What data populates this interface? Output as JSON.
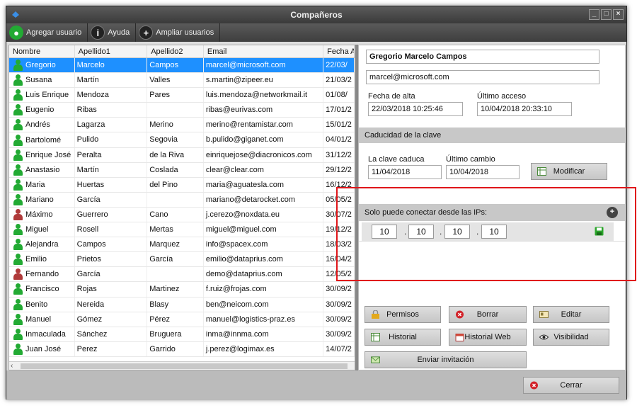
{
  "window": {
    "title": "Compañeros"
  },
  "toolbar": {
    "add_user": "Agregar usuario",
    "help": "Ayuda",
    "expand_users": "Ampliar usuarios"
  },
  "columns": [
    "Nombre",
    "Apellido1",
    "Apellido2",
    "Email",
    "Fecha A"
  ],
  "rows": [
    {
      "n": "Gregorio",
      "a1": "Marcelo",
      "a2": "Campos",
      "e": "marcel@microsoft.com",
      "f": "22/03/",
      "status": "green"
    },
    {
      "n": "Susana",
      "a1": "Martín",
      "a2": "Valles",
      "e": "s.martin@zipeer.eu",
      "f": "21/03/2",
      "status": "green"
    },
    {
      "n": "Luis Enrique",
      "a1": "Mendoza",
      "a2": "Pares",
      "e": "luis.mendoza@networkmail.it",
      "f": "01/08/",
      "status": "green"
    },
    {
      "n": "Eugenio",
      "a1": "Ribas",
      "a2": "",
      "e": "ribas@eurivas.com",
      "f": "17/01/2",
      "status": "green"
    },
    {
      "n": "Andrés",
      "a1": "Lagarza",
      "a2": "Merino",
      "e": "merino@rentamistar.com",
      "f": "15/01/2",
      "status": "green"
    },
    {
      "n": "Bartolomé",
      "a1": "Pulido",
      "a2": "Segovia",
      "e": "b.pulido@giganet.com",
      "f": "04/01/2",
      "status": "green"
    },
    {
      "n": "Enrique José",
      "a1": "Peralta",
      "a2": "de la Riva",
      "e": "einriquejose@diacronicos.com",
      "f": "31/12/2",
      "status": "green"
    },
    {
      "n": "Anastasio",
      "a1": "Martín",
      "a2": "Coslada",
      "e": "clear@clear.com",
      "f": "29/12/2",
      "status": "green"
    },
    {
      "n": "Maria",
      "a1": "Huertas",
      "a2": "del Pino",
      "e": "maria@aguatesla.com",
      "f": "16/12/2",
      "status": "green"
    },
    {
      "n": "Mariano",
      "a1": "García",
      "a2": "",
      "e": "mariano@detarocket.com",
      "f": "05/05/2",
      "status": "green"
    },
    {
      "n": "Máximo",
      "a1": "Guerrero",
      "a2": "Cano",
      "e": "j.cerezo@noxdata.eu",
      "f": "30/07/2",
      "status": "red"
    },
    {
      "n": "Miguel",
      "a1": "Rosell",
      "a2": "Mertas",
      "e": "miguel@miguel.com",
      "f": "19/12/2",
      "status": "green"
    },
    {
      "n": "Alejandra",
      "a1": "Campos",
      "a2": "Marquez",
      "e": "info@spacex.com",
      "f": "18/03/2",
      "status": "green"
    },
    {
      "n": "Emilio",
      "a1": "Prietos",
      "a2": "García",
      "e": "emilio@dataprius.com",
      "f": "16/04/2",
      "status": "green"
    },
    {
      "n": "Fernando",
      "a1": "García",
      "a2": "",
      "e": "demo@dataprius.com",
      "f": "12/05/2",
      "status": "red"
    },
    {
      "n": "Francisco",
      "a1": "Rojas",
      "a2": "Martinez",
      "e": "f.ruiz@frojas.com",
      "f": "30/09/2",
      "status": "green"
    },
    {
      "n": "Benito",
      "a1": "Nereida",
      "a2": "Blasy",
      "e": "ben@neicom.com",
      "f": "30/09/2",
      "status": "green"
    },
    {
      "n": "Manuel",
      "a1": "Gómez",
      "a2": "Pérez",
      "e": "manuel@logistics-praz.es",
      "f": "30/09/2",
      "status": "green"
    },
    {
      "n": "Inmaculada",
      "a1": "Sánchez",
      "a2": "Bruguera",
      "e": "inma@innma.com",
      "f": "30/09/2",
      "status": "green"
    },
    {
      "n": "Juan José",
      "a1": "Perez",
      "a2": "Garrido",
      "e": "j.perez@logimax.es",
      "f": "14/07/2",
      "status": "green"
    }
  ],
  "detail": {
    "name": "Gregorio Marcelo Campos",
    "email": "marcel@microsoft.com",
    "created_label": "Fecha de alta",
    "created": "22/03/2018 10:25:46",
    "last_access_label": "Último acceso",
    "last_access": "10/04/2018 20:33:10",
    "expiry_section": "Caducidad de la clave",
    "expires_label": "La clave caduca",
    "expires": "11/04/2018",
    "last_change_label": "Último cambio",
    "last_change": "10/04/2018",
    "modify": "Modificar",
    "ip_section": "Solo puede conectar desde las IPs:",
    "ip": [
      "10",
      "10",
      "10",
      "10"
    ]
  },
  "actions": {
    "permisos": "Permisos",
    "borrar": "Borrar",
    "editar": "Editar",
    "historial": "Historial",
    "historial_web": "Historial Web",
    "visibilidad": "Visibilidad",
    "enviar": "Enviar invitación",
    "cerrar": "Cerrar"
  },
  "colors": {
    "selected": "#1e90ff",
    "status_green": "#22aa33",
    "status_red": "#b03a3a",
    "highlight": "#e0161a"
  }
}
